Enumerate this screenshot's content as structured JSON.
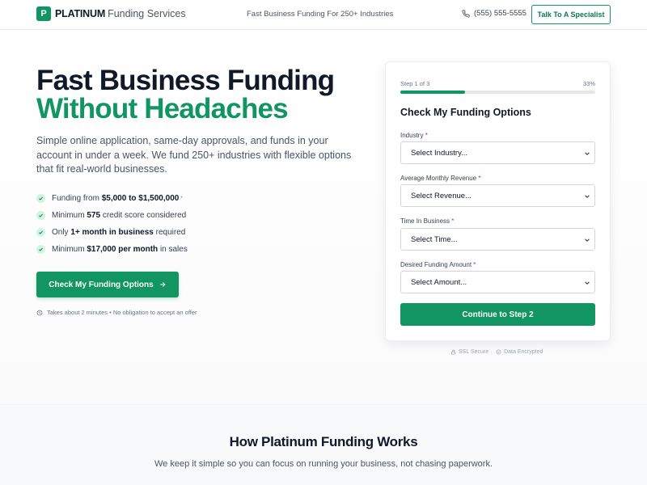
{
  "header": {
    "logo_letter": "P",
    "brand_bold": "PLATINUM",
    "brand_rest": "Funding Services",
    "tagline": "Fast Business Funding For 250+ Industries",
    "phone": "(555) 555-5555",
    "talk_button": "Talk To A Specialist"
  },
  "hero": {
    "title_line1": "Fast Business Funding",
    "title_line2": "Without Headaches",
    "lead": "Simple online application, same-day approvals, and funds in your account in under a week. We fund 250+ industries with flexible options that fit real-world businesses.",
    "features": [
      {
        "pre": "Funding from ",
        "bold": "$5,000 to $1,500,000",
        "post": " *"
      },
      {
        "pre": "Minimum ",
        "bold": "575",
        "post": " credit score considered"
      },
      {
        "pre": "Only ",
        "bold": "1+ month in business",
        "post": " required"
      },
      {
        "pre": "Minimum ",
        "bold": "$17,000 per month",
        "post": " in sales"
      }
    ],
    "cta": "Check My Funding Options",
    "note": "Takes about 2 minutes • No obligation to accept an offer"
  },
  "form": {
    "step_label": "Step 1 of 3",
    "step_pct": "33%",
    "progress": 0.33,
    "title": "Check My Funding Options",
    "fields": [
      {
        "label": "Industry",
        "required": "*",
        "value": "Select Industry..."
      },
      {
        "label": "Average Monthly Revenue",
        "required": "*",
        "value": "Select Revenue..."
      },
      {
        "label": "Time In Business",
        "required": "*",
        "value": "Select Time..."
      },
      {
        "label": "Desired Funding Amount",
        "required": "*",
        "value": "Select Amount..."
      }
    ],
    "continue": "Continue to Step 2",
    "badge_ssl": "SSL Secure",
    "badge_encrypted": "Data Encrypted"
  },
  "how": {
    "title": "How Platinum Funding Works",
    "subtitle": "We keep it simple so you can focus on running your business, not chasing paperwork."
  },
  "colors": {
    "brand": "#109563",
    "required": "#e11d48"
  }
}
